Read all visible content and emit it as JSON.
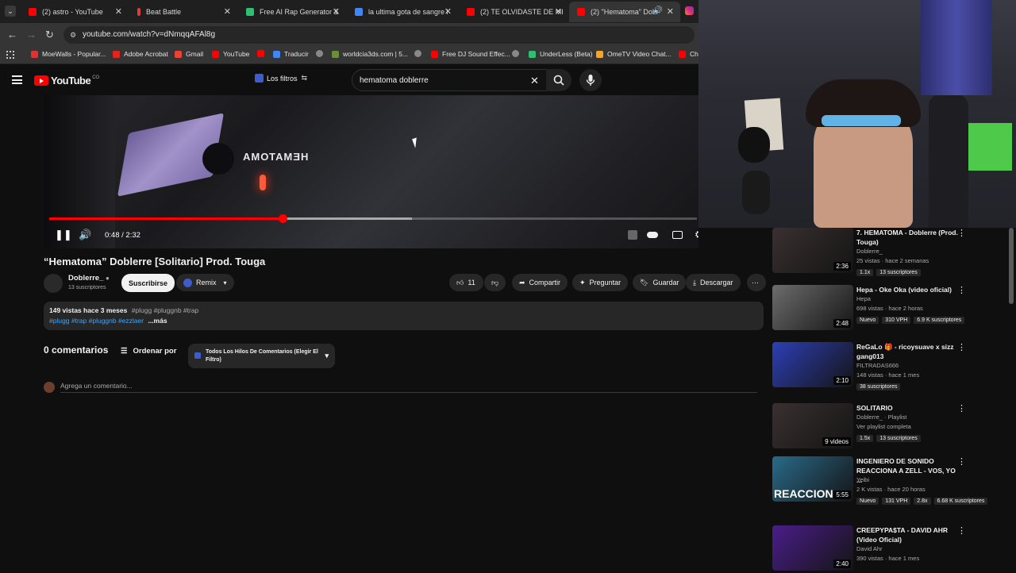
{
  "tabs": [
    {
      "label": "(2) astro - YouTube",
      "color": "#ff0000"
    },
    {
      "label": "Beat Battle",
      "color": "#e03a3a"
    },
    {
      "label": "Free AI Rap Generator &",
      "color": "#2fbf71"
    },
    {
      "label": "la ultima gota de sangre l",
      "color": "#4285f4"
    },
    {
      "label": "(2) TE OLVIDASTE DE MI",
      "color": "#ff0000"
    },
    {
      "label": "(2) \"Hematoma\" Dobl",
      "color": "#ff0000"
    }
  ],
  "url": "youtube.com/watch?v=dNmqqAFAl8g",
  "bookmarks": [
    "MoeWalls - Popular...",
    "Adobe Acrobat",
    "Gmail",
    "YouTube",
    "Traducir",
    "worldcia3ds.com | 5...",
    "Free DJ Sound Effec...",
    "UnderLess (Beta)",
    "OmeTV Video Chat...",
    "Ch"
  ],
  "youtube": {
    "logo": "YouTube",
    "country": "CO",
    "filters_label": "Los filtros",
    "search_value": "hematoma doblerre"
  },
  "player": {
    "time": "0:48 / 2:32",
    "played_fraction": 0.36,
    "buffered_fraction": 0.56,
    "sign_text": "HEMATOMA"
  },
  "video": {
    "title": "“Hematoma” Doblerre [Solitario] Prod. Touga",
    "channel": "Doblerre_",
    "subscribers": "13 suscriptores",
    "subscribe_label": "Suscribirse",
    "remix_label": "Remix",
    "likes": "11",
    "share_label": "Compartir",
    "ask_label": "Preguntar",
    "save_label": "Guardar",
    "download_label": "Descargar",
    "desc_stats": "149 vistas  hace 3 meses",
    "desc_tags_1": "#plugg #pluggnb #trap",
    "desc_tags_2": "#plugg #trap #pluggnb #ezzlaer",
    "desc_more": "...más"
  },
  "comments": {
    "count_label": "0 comentarios",
    "sort_label": "Ordenar por",
    "filter_label": "Todos Los Hilos De Comentarios (Elegir El Filtro)",
    "add_placeholder": "Agrega un comentario..."
  },
  "recommendations": [
    {
      "title": "7. HEMATOMA - Doblerre (Prod. Touga)",
      "channel": "Doblerre_",
      "stats": "25 vistas · hace 2 semanas",
      "duration": "2:36",
      "tags": [
        "1.1x",
        "13 suscriptores"
      ],
      "color": "#3a3030"
    },
    {
      "title": "Hepa - Oke Oka (video oficial)",
      "channel": "Hepa",
      "stats": "698 vistas · hace 2 horas",
      "duration": "2:48",
      "tags": [
        "Nuevo",
        "310 VPH",
        "6.9 K suscriptores"
      ],
      "color": "#6d6d6d"
    },
    {
      "title": "ReGaLo 🎁 - ricoysuave x sizz gang013",
      "channel": "FILTRADAS666",
      "stats": "148 vistas · hace 1 mes",
      "duration": "2:10",
      "tags": [
        "38 suscriptores"
      ],
      "color": "#2d3fb5"
    },
    {
      "title": "SOLITARIO",
      "channel": "Doblerre_ · Playlist",
      "stats": "Ver playlist completa",
      "duration": "9 videos",
      "tags": [
        "1.5x",
        "13 suscriptores"
      ],
      "color": "#3a3030"
    },
    {
      "title": "INGENIERO DE SONIDO REACCIONA A ZELL - VOS, YO ...",
      "channel": "Yeibi",
      "stats": "2 K vistas · hace 20 horas",
      "duration": "5:55",
      "tags": [
        "Nuevo",
        "131 VPH",
        "2.8x",
        "6.68 K suscriptores"
      ],
      "color": "#2a6a8a",
      "overlay": "REACCION"
    },
    {
      "title": "CREEPYPA$TA - DAVID AHR (Video Oficial)",
      "channel": "David Ahr",
      "stats": "390 vistas · hace 1 mes",
      "duration": "2:40",
      "tags": [],
      "color": "#4a1d8a"
    }
  ]
}
